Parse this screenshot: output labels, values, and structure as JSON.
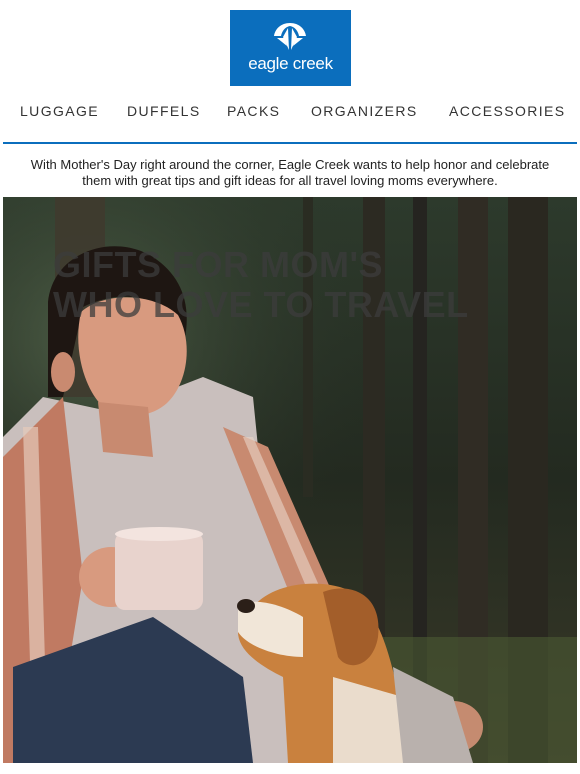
{
  "brand": {
    "name": "eagle creek",
    "color": "#0b6ebd"
  },
  "nav": {
    "items": [
      {
        "label": "LUGGAGE"
      },
      {
        "label": "DUFFELS"
      },
      {
        "label": "PACKS"
      },
      {
        "label": "ORGANIZERS"
      },
      {
        "label": "ACCESSORIES"
      }
    ]
  },
  "intro": {
    "text": "With Mother's Day right around the corner, Eagle Creek wants to help honor and celebrate them with great tips and gift ideas for all travel loving moms everywhere."
  },
  "hero": {
    "title_line1": "GIFTS FOR MOM'S",
    "title_line2": "WHO LOVE TO TRAVEL"
  }
}
